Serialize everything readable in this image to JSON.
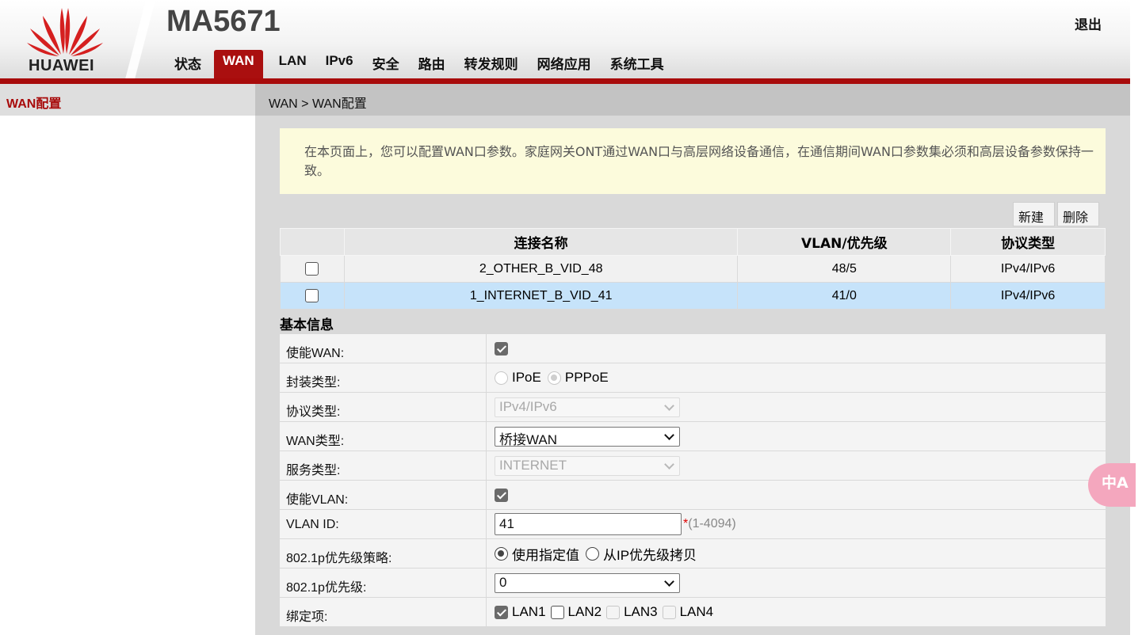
{
  "header": {
    "logo_text": "HUAWEI",
    "product": "MA5671",
    "logout": "退出",
    "nav": [
      {
        "label": "状态",
        "active": false
      },
      {
        "label": "WAN",
        "active": true
      },
      {
        "label": "LAN",
        "active": false
      },
      {
        "label": "IPv6",
        "active": false
      },
      {
        "label": "安全",
        "active": false
      },
      {
        "label": "路由",
        "active": false
      },
      {
        "label": "转发规则",
        "active": false
      },
      {
        "label": "网络应用",
        "active": false
      },
      {
        "label": "系统工具",
        "active": false
      }
    ]
  },
  "sidebar": {
    "items": [
      {
        "label": "WAN配置"
      }
    ]
  },
  "main": {
    "breadcrumb": "WAN > WAN配置",
    "notice": "在本页面上，您可以配置WAN口参数。家庭网关ONT通过WAN口与高层网络设备通信，在通信期间WAN口参数集必须和高层设备参数保持一致。",
    "buttons": {
      "new": "新建",
      "delete": "删除"
    },
    "table": {
      "headers": [
        "",
        "连接名称",
        "VLAN/优先级",
        "协议类型"
      ],
      "rows": [
        {
          "name": "2_OTHER_B_VID_48",
          "vlan": "48/5",
          "protocol": "IPv4/IPv6",
          "selected": false
        },
        {
          "name": "1_INTERNET_B_VID_41",
          "vlan": "41/0",
          "protocol": "IPv4/IPv6",
          "selected": true
        }
      ]
    },
    "basic_title": "基本信息",
    "form": {
      "enable_wan": {
        "label": "使能WAN:",
        "checked": true
      },
      "encap": {
        "label": "封装类型:",
        "options": [
          "IPoE",
          "PPPoE"
        ],
        "selected": "PPPoE"
      },
      "protocol": {
        "label": "协议类型:",
        "value": "IPv4/IPv6"
      },
      "wan_type": {
        "label": "WAN类型:",
        "value": "桥接WAN"
      },
      "service": {
        "label": "服务类型:",
        "value": "INTERNET"
      },
      "enable_vlan": {
        "label": "使能VLAN:",
        "checked": true
      },
      "vlan_id": {
        "label": "VLAN ID:",
        "value": "41",
        "required": "*",
        "hint": "(1-4094)"
      },
      "p8021_policy": {
        "label": "802.1p优先级策略:",
        "options": [
          "使用指定值",
          "从IP优先级拷贝"
        ],
        "selected": "使用指定值"
      },
      "p8021_priority": {
        "label": "802.1p优先级:",
        "value": "0"
      },
      "binding": {
        "label": "绑定项:",
        "options": [
          {
            "label": "LAN1",
            "checked": true,
            "enabled": true
          },
          {
            "label": "LAN2",
            "checked": false,
            "enabled": true
          },
          {
            "label": "LAN3",
            "checked": false,
            "enabled": false
          },
          {
            "label": "LAN4",
            "checked": false,
            "enabled": false
          }
        ]
      }
    }
  },
  "translate_badge": "中A",
  "colors": {
    "brand_red": "#a80b0b",
    "selected_row": "#c6e3fa",
    "notice_bg": "#fcfbdc"
  }
}
